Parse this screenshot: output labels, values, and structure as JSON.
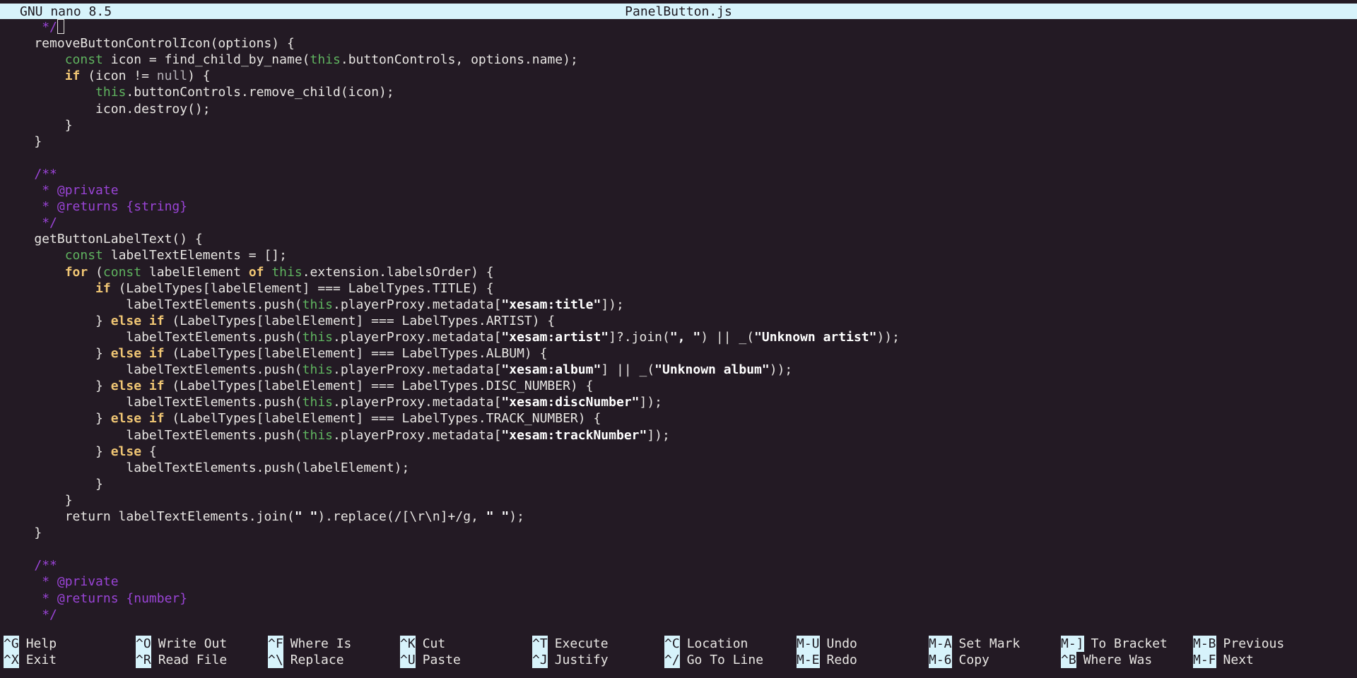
{
  "titlebar": {
    "version": "GNU nano 8.5",
    "filename": "PanelButton.js"
  },
  "code_lines": [
    [
      {
        "t": "     ",
        "c": ""
      },
      {
        "t": "*/",
        "c": "cmt"
      }
    ],
    [
      {
        "t": "    removeButtonControlIcon(options) {",
        "c": ""
      }
    ],
    [
      {
        "t": "        ",
        "c": ""
      },
      {
        "t": "const",
        "c": "decl"
      },
      {
        "t": " icon = find_child_by_name(",
        "c": ""
      },
      {
        "t": "this",
        "c": "thisk"
      },
      {
        "t": ".buttonControls, options.name);",
        "c": ""
      }
    ],
    [
      {
        "t": "        ",
        "c": ""
      },
      {
        "t": "if",
        "c": "kw"
      },
      {
        "t": " (icon != ",
        "c": ""
      },
      {
        "t": "null",
        "c": "nullk"
      },
      {
        "t": ") {",
        "c": ""
      }
    ],
    [
      {
        "t": "            ",
        "c": ""
      },
      {
        "t": "this",
        "c": "thisk"
      },
      {
        "t": ".buttonControls.remove_child(icon);",
        "c": ""
      }
    ],
    [
      {
        "t": "            icon.destroy();",
        "c": ""
      }
    ],
    [
      {
        "t": "        }",
        "c": ""
      }
    ],
    [
      {
        "t": "    }",
        "c": ""
      }
    ],
    [
      {
        "t": "",
        "c": ""
      }
    ],
    [
      {
        "t": "    ",
        "c": ""
      },
      {
        "t": "/**",
        "c": "cmt"
      }
    ],
    [
      {
        "t": "     ",
        "c": ""
      },
      {
        "t": "* @private",
        "c": "cmt"
      }
    ],
    [
      {
        "t": "     ",
        "c": ""
      },
      {
        "t": "* @returns {string}",
        "c": "cmt"
      }
    ],
    [
      {
        "t": "     ",
        "c": ""
      },
      {
        "t": "*/",
        "c": "cmt"
      }
    ],
    [
      {
        "t": "    getButtonLabelText() {",
        "c": ""
      }
    ],
    [
      {
        "t": "        ",
        "c": ""
      },
      {
        "t": "const",
        "c": "decl"
      },
      {
        "t": " labelTextElements = [];",
        "c": ""
      }
    ],
    [
      {
        "t": "        ",
        "c": ""
      },
      {
        "t": "for",
        "c": "kw"
      },
      {
        "t": " (",
        "c": ""
      },
      {
        "t": "const",
        "c": "decl"
      },
      {
        "t": " labelElement ",
        "c": ""
      },
      {
        "t": "of",
        "c": "kw"
      },
      {
        "t": " ",
        "c": ""
      },
      {
        "t": "this",
        "c": "thisk"
      },
      {
        "t": ".extension.labelsOrder) {",
        "c": ""
      }
    ],
    [
      {
        "t": "            ",
        "c": ""
      },
      {
        "t": "if",
        "c": "kw"
      },
      {
        "t": " (LabelTypes[labelElement] === LabelTypes.TITLE) {",
        "c": ""
      }
    ],
    [
      {
        "t": "                labelTextElements.push(",
        "c": ""
      },
      {
        "t": "this",
        "c": "thisk"
      },
      {
        "t": ".playerProxy.metadata[",
        "c": ""
      },
      {
        "t": "\"xesam:title\"",
        "c": "str"
      },
      {
        "t": "]);",
        "c": ""
      }
    ],
    [
      {
        "t": "            } ",
        "c": ""
      },
      {
        "t": "else if",
        "c": "kw"
      },
      {
        "t": " (LabelTypes[labelElement] === LabelTypes.ARTIST) {",
        "c": ""
      }
    ],
    [
      {
        "t": "                labelTextElements.push(",
        "c": ""
      },
      {
        "t": "this",
        "c": "thisk"
      },
      {
        "t": ".playerProxy.metadata[",
        "c": ""
      },
      {
        "t": "\"xesam:artist\"",
        "c": "str"
      },
      {
        "t": "]?.join(",
        "c": ""
      },
      {
        "t": "\", \"",
        "c": "str"
      },
      {
        "t": ") || _(",
        "c": ""
      },
      {
        "t": "\"Unknown artist\"",
        "c": "str"
      },
      {
        "t": "));",
        "c": ""
      }
    ],
    [
      {
        "t": "            } ",
        "c": ""
      },
      {
        "t": "else if",
        "c": "kw"
      },
      {
        "t": " (LabelTypes[labelElement] === LabelTypes.ALBUM) {",
        "c": ""
      }
    ],
    [
      {
        "t": "                labelTextElements.push(",
        "c": ""
      },
      {
        "t": "this",
        "c": "thisk"
      },
      {
        "t": ".playerProxy.metadata[",
        "c": ""
      },
      {
        "t": "\"xesam:album\"",
        "c": "str"
      },
      {
        "t": "] || _(",
        "c": ""
      },
      {
        "t": "\"Unknown album\"",
        "c": "str"
      },
      {
        "t": "));",
        "c": ""
      }
    ],
    [
      {
        "t": "            } ",
        "c": ""
      },
      {
        "t": "else if",
        "c": "kw"
      },
      {
        "t": " (LabelTypes[labelElement] === LabelTypes.DISC_NUMBER) {",
        "c": ""
      }
    ],
    [
      {
        "t": "                labelTextElements.push(",
        "c": ""
      },
      {
        "t": "this",
        "c": "thisk"
      },
      {
        "t": ".playerProxy.metadata[",
        "c": ""
      },
      {
        "t": "\"xesam:discNumber\"",
        "c": "str"
      },
      {
        "t": "]);",
        "c": ""
      }
    ],
    [
      {
        "t": "            } ",
        "c": ""
      },
      {
        "t": "else if",
        "c": "kw"
      },
      {
        "t": " (LabelTypes[labelElement] === LabelTypes.TRACK_NUMBER) {",
        "c": ""
      }
    ],
    [
      {
        "t": "                labelTextElements.push(",
        "c": ""
      },
      {
        "t": "this",
        "c": "thisk"
      },
      {
        "t": ".playerProxy.metadata[",
        "c": ""
      },
      {
        "t": "\"xesam:trackNumber\"",
        "c": "str"
      },
      {
        "t": "]);",
        "c": ""
      }
    ],
    [
      {
        "t": "            } ",
        "c": ""
      },
      {
        "t": "else",
        "c": "kw"
      },
      {
        "t": " {",
        "c": ""
      }
    ],
    [
      {
        "t": "                labelTextElements.push(labelElement);",
        "c": ""
      }
    ],
    [
      {
        "t": "            }",
        "c": ""
      }
    ],
    [
      {
        "t": "        }",
        "c": ""
      }
    ],
    [
      {
        "t": "        return labelTextElements.join(",
        "c": ""
      },
      {
        "t": "\" \"",
        "c": "str"
      },
      {
        "t": ").replace(/[\\r\\n]+/g, ",
        "c": ""
      },
      {
        "t": "\" \"",
        "c": "str"
      },
      {
        "t": ");",
        "c": ""
      }
    ],
    [
      {
        "t": "    }",
        "c": ""
      }
    ],
    [
      {
        "t": "",
        "c": ""
      }
    ],
    [
      {
        "t": "    ",
        "c": ""
      },
      {
        "t": "/**",
        "c": "cmt"
      }
    ],
    [
      {
        "t": "     ",
        "c": ""
      },
      {
        "t": "* @private",
        "c": "cmt"
      }
    ],
    [
      {
        "t": "     ",
        "c": ""
      },
      {
        "t": "* @returns {number}",
        "c": "cmt"
      }
    ],
    [
      {
        "t": "     ",
        "c": ""
      },
      {
        "t": "*/",
        "c": "cmt"
      }
    ]
  ],
  "shortcuts": {
    "row1": [
      {
        "key": "^G",
        "label": "Help"
      },
      {
        "key": "^O",
        "label": "Write Out"
      },
      {
        "key": "^F",
        "label": "Where Is"
      },
      {
        "key": "^K",
        "label": "Cut"
      },
      {
        "key": "^T",
        "label": "Execute"
      },
      {
        "key": "^C",
        "label": "Location"
      },
      {
        "key": "M-U",
        "label": "Undo"
      },
      {
        "key": "M-A",
        "label": "Set Mark"
      },
      {
        "key": "M-]",
        "label": "To Bracket"
      },
      {
        "key": "M-B",
        "label": "Previous"
      }
    ],
    "row2": [
      {
        "key": "^X",
        "label": "Exit"
      },
      {
        "key": "^R",
        "label": "Read File"
      },
      {
        "key": "^\\",
        "label": "Replace"
      },
      {
        "key": "^U",
        "label": "Paste"
      },
      {
        "key": "^J",
        "label": "Justify"
      },
      {
        "key": "^/",
        "label": "Go To Line"
      },
      {
        "key": "M-E",
        "label": "Redo"
      },
      {
        "key": "M-6",
        "label": "Copy"
      },
      {
        "key": "^B",
        "label": "Where Was"
      },
      {
        "key": "M-F",
        "label": "Next"
      }
    ]
  }
}
